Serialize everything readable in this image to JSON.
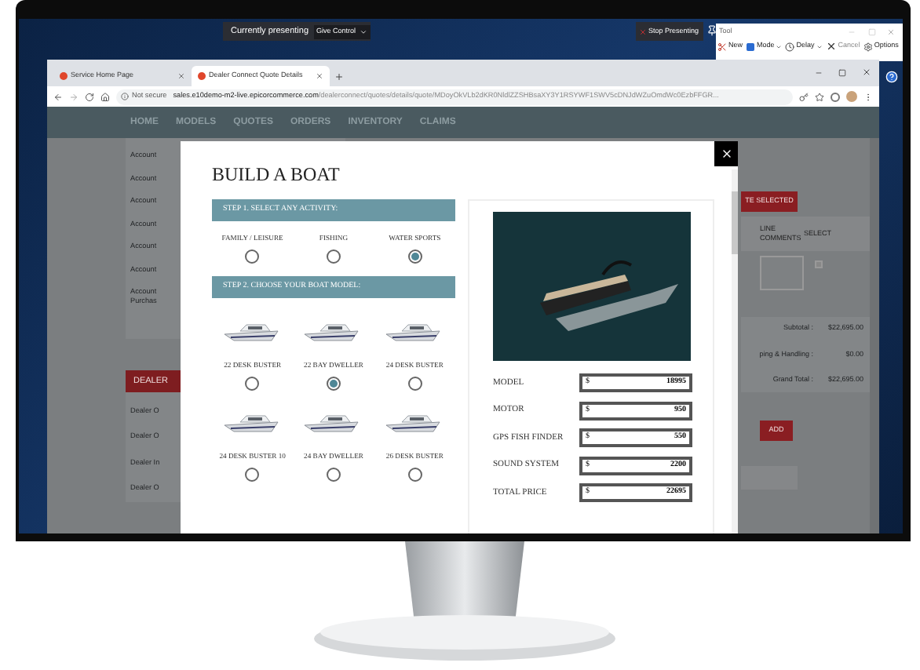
{
  "presenter_bar": {
    "status": "Currently presenting",
    "give_control": "Give Control",
    "stop": "Stop Presenting"
  },
  "snip_tool": {
    "title": "Tool",
    "toolbar": [
      {
        "kind": "new",
        "label": "New",
        "disabled": false,
        "dropdown": false
      },
      {
        "kind": "mode",
        "label": "Mode",
        "disabled": false,
        "dropdown": true
      },
      {
        "kind": "delay",
        "label": "Delay",
        "disabled": false,
        "dropdown": true
      },
      {
        "kind": "cancel",
        "label": "Cancel",
        "disabled": true,
        "dropdown": false
      },
      {
        "kind": "options",
        "label": "Options",
        "disabled": false,
        "dropdown": false
      }
    ]
  },
  "browser": {
    "tabs": [
      {
        "title": "Service Home Page",
        "selected": false
      },
      {
        "title": "Dealer Connect Quote Details",
        "selected": true
      }
    ],
    "security": "Not secure",
    "url_host": "sales.e10demo-m2-live.epicorcommerce.com",
    "url_path": "/dealerconnect/quotes/details/quote/MDoyOkVLb2dKR0NldlZZSHBsaXY3Y1RSYWF1SWV5cDNJdWZuOmdWc0EzbFFGR..."
  },
  "nav": [
    "HOME",
    "MODELS",
    "QUOTES",
    "ORDERS",
    "INVENTORY",
    "CLAIMS"
  ],
  "page": {
    "account_items": [
      "Account",
      "Account",
      "Account",
      "Account",
      "Account",
      "Account",
      "Account Purchas"
    ],
    "dealer_header": "DEALER",
    "dealer_items": [
      "Dealer O",
      "Dealer O",
      "Dealer In",
      "Dealer O"
    ],
    "action_button": "TE SELECTED",
    "columns": [
      "LINE COMMENTS",
      "SELECT"
    ],
    "select_checked": false,
    "totals": [
      {
        "label": "Subtotal :",
        "value": "$22,695.00"
      },
      {
        "label": "ping & Handling :",
        "value": "$0.00"
      },
      {
        "label": "Grand Total :",
        "value": "$22,695.00"
      }
    ],
    "add_button": "ADD"
  },
  "modal": {
    "title": "BUILD A BOAT",
    "step1": "STEP 1. SELECT ANY ACTIVITY:",
    "activities": [
      {
        "label": "FAMILY / LEISURE",
        "selected": false
      },
      {
        "label": "FISHING",
        "selected": false
      },
      {
        "label": "WATER SPORTS",
        "selected": true
      }
    ],
    "step2": "STEP 2. CHOOSE YOUR BOAT MODEL:",
    "boats": [
      {
        "name": "22 DESK BUSTER",
        "selected": false
      },
      {
        "name": "22 BAY DWELLER",
        "selected": true
      },
      {
        "name": "24 DESK BUSTER",
        "selected": false
      },
      {
        "name": "24 DESK BUSTER 10",
        "selected": false
      },
      {
        "name": "24 BAY DWELLER",
        "selected": false
      },
      {
        "name": "26 DESK BUSTER",
        "selected": false
      }
    ],
    "prices": [
      {
        "label": "MODEL",
        "currency": "$",
        "value": "18995"
      },
      {
        "label": "MOTOR",
        "currency": "$",
        "value": "950"
      },
      {
        "label": "GPS FISH FINDER",
        "currency": "$",
        "value": "550"
      },
      {
        "label": "SOUND SYSTEM",
        "currency": "$",
        "value": "2200"
      },
      {
        "label": "TOTAL PRICE",
        "currency": "$",
        "value": "22695"
      }
    ]
  }
}
